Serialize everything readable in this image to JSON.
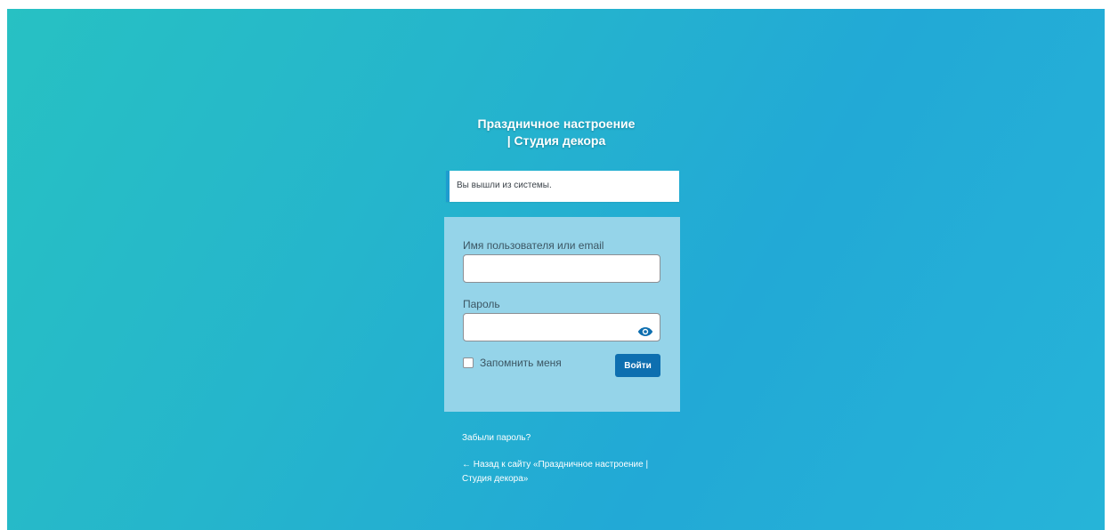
{
  "site": {
    "title_line1": "Праздничное настроение",
    "title_line2": "| Студия декора"
  },
  "notice": {
    "text": "Вы вышли из системы."
  },
  "form": {
    "username_label": "Имя пользователя или email",
    "username_value": "",
    "password_label": "Пароль",
    "password_value": "",
    "remember_label": "Запомнить меня",
    "submit_label": "Войти"
  },
  "links": {
    "lost_password": "Забыли пароль?",
    "back_to_site": "← Назад к сайту «Праздничное настроение | Студия декора»"
  },
  "icons": {
    "password_toggle": "eye-icon"
  },
  "colors": {
    "accent": "#0e6fb0",
    "notice_border": "#1e9ccf"
  }
}
